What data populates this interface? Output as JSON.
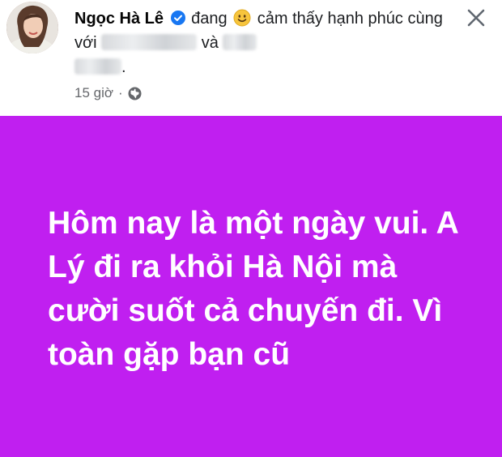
{
  "post": {
    "author": "Ngọc Hà Lê",
    "feeling_prefix": "đang",
    "feeling_text": "cảm thấy hạnh phúc cùng với",
    "and_word": "và",
    "period": ".",
    "time": "15 giờ",
    "separator": "·",
    "icons": {
      "verified": "verified-badge-icon",
      "emoji": "smiling-face-icon",
      "audience": "globe-icon",
      "close": "close-icon"
    }
  },
  "banner": {
    "background": "#c01ff0",
    "text": "Hôm nay là một ngày vui. A Lý đi ra khỏi Hà Nội mà cười suốt cả chuyến đi. Vì toàn gặp bạn cũ"
  }
}
